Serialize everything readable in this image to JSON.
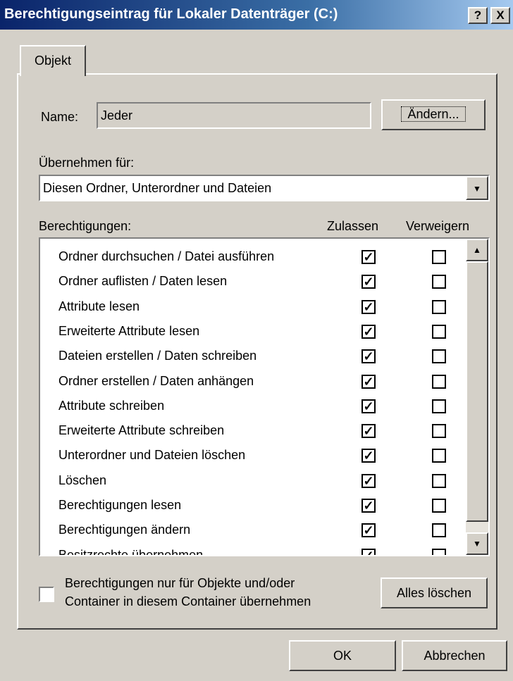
{
  "window": {
    "title": "Berechtigungseintrag für Lokaler Datenträger (C:)",
    "help_button": "?",
    "close_button": "X"
  },
  "tabs": [
    {
      "label": "Objekt"
    }
  ],
  "name": {
    "label": "Name:",
    "value": "Jeder",
    "change_button": "Ändern..."
  },
  "apply_to": {
    "label": "Übernehmen für:",
    "selected": "Diesen Ordner, Unterordner und Dateien"
  },
  "permissions": {
    "label": "Berechtigungen:",
    "col_allow": "Zulassen",
    "col_deny": "Verweigern",
    "items": [
      {
        "name": "Ordner durchsuchen / Datei ausführen",
        "allow": true,
        "deny": false
      },
      {
        "name": "Ordner auflisten / Daten lesen",
        "allow": true,
        "deny": false
      },
      {
        "name": "Attribute lesen",
        "allow": true,
        "deny": false
      },
      {
        "name": "Erweiterte Attribute lesen",
        "allow": true,
        "deny": false
      },
      {
        "name": "Dateien erstellen / Daten schreiben",
        "allow": true,
        "deny": false
      },
      {
        "name": "Ordner erstellen / Daten anhängen",
        "allow": true,
        "deny": false
      },
      {
        "name": "Attribute schreiben",
        "allow": true,
        "deny": false
      },
      {
        "name": "Erweiterte Attribute schreiben",
        "allow": true,
        "deny": false
      },
      {
        "name": "Unterordner und Dateien löschen",
        "allow": true,
        "deny": false
      },
      {
        "name": "Löschen",
        "allow": true,
        "deny": false
      },
      {
        "name": "Berechtigungen lesen",
        "allow": true,
        "deny": false
      },
      {
        "name": "Berechtigungen ändern",
        "allow": true,
        "deny": false
      },
      {
        "name": "Besitzrechte übernehmen",
        "allow": true,
        "deny": false
      }
    ]
  },
  "inherit_checkbox": {
    "checked": false,
    "label_line1": "Berechtigungen nur für Objekte und/oder",
    "label_line2": "Container in diesem Container übernehmen"
  },
  "clear_all_button": "Alles löschen",
  "footer": {
    "ok": "OK",
    "cancel": "Abbrechen"
  }
}
